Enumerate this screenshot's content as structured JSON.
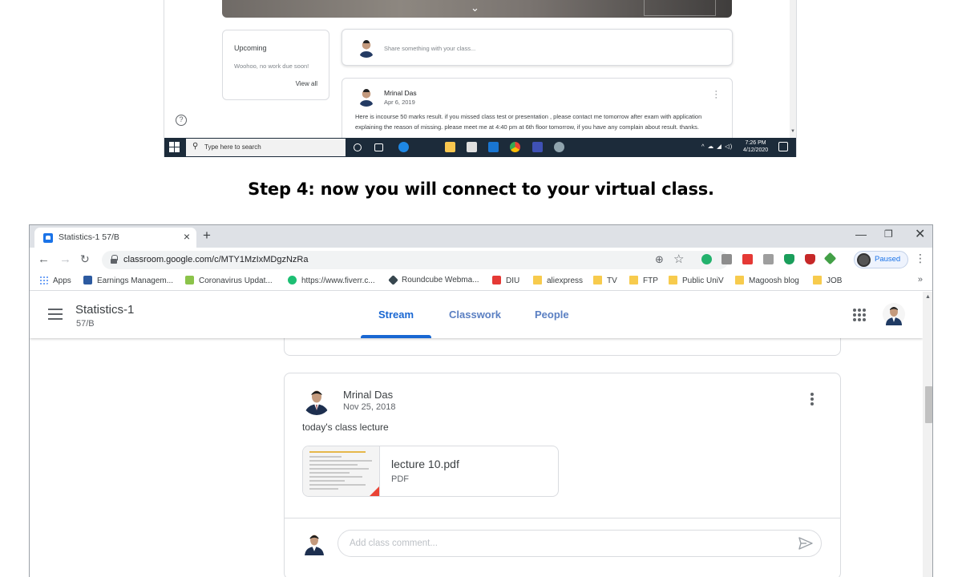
{
  "top_screenshot": {
    "upcoming": {
      "title": "Upcoming",
      "text": "Woohoo, no work due soon!",
      "view_all": "View all"
    },
    "share_placeholder": "Share something with your class...",
    "post": {
      "author": "Mrinal Das",
      "date": "Apr 6, 2019",
      "body": "Here is incourse 50 marks result. if you missed class test or presentation , please contact me tomorrow after exam with application explaining the reason of missing. please meet me at 4:40 pm at 6th floor tomorrow, if you have any complain about result. thanks."
    },
    "taskbar": {
      "search_placeholder": "Type here to search",
      "time": "7:26 PM",
      "date": "4/12/2020"
    }
  },
  "caption": "Step 4: now you will connect to your virtual class.",
  "browser": {
    "tab_title": "Statistics-1 57/B",
    "url": "classroom.google.com/c/MTY1MzIxMDgzNzRa",
    "profile_status": "Paused",
    "bookmarks": [
      {
        "label": "Apps",
        "color": "#4285f4"
      },
      {
        "label": "Earnings Managem...",
        "color": "#2c5aa0"
      },
      {
        "label": "Coronavirus Updat...",
        "color": "#8bc34a"
      },
      {
        "label": "https://www.fiverr.c...",
        "color": "#1dbf73"
      },
      {
        "label": "Roundcube Webma...",
        "color": "#37474f"
      },
      {
        "label": "DIU",
        "color": "#e53935"
      },
      {
        "label": "aliexpress",
        "color": "#f7cb4d"
      },
      {
        "label": "TV",
        "color": "#f7cb4d"
      },
      {
        "label": "FTP",
        "color": "#f7cb4d"
      },
      {
        "label": "Public UniV",
        "color": "#f7cb4d"
      },
      {
        "label": "Magoosh blog",
        "color": "#f7cb4d"
      },
      {
        "label": "JOB",
        "color": "#f7cb4d"
      }
    ]
  },
  "classroom": {
    "class_name": "Statistics-1",
    "section": "57/B",
    "tabs": [
      "Stream",
      "Classwork",
      "People"
    ],
    "post": {
      "author": "Mrinal Das",
      "date": "Nov 25, 2018",
      "text": "today's class lecture",
      "attachment": {
        "name": "lecture 10.pdf",
        "type": "PDF"
      }
    },
    "comment_placeholder": "Add class comment..."
  },
  "colors": {
    "accent": "#1967d2",
    "taskbar": "#1c2b3a"
  }
}
